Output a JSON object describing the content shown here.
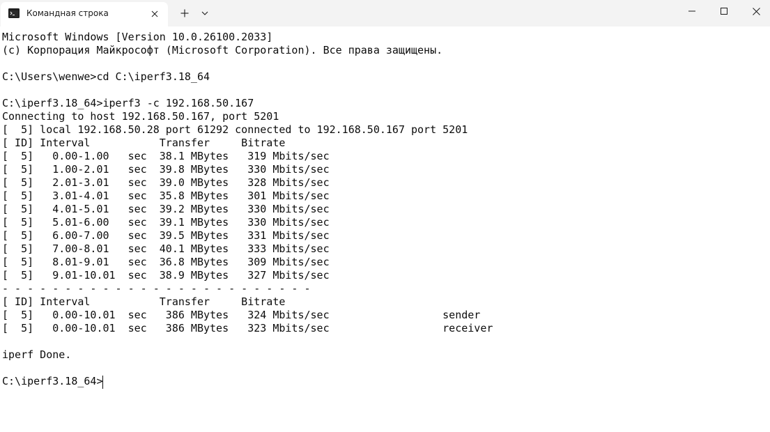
{
  "window": {
    "tab_title": "Командная строка",
    "tab_icon": "console-icon",
    "close_tab_icon": "close-icon",
    "new_tab_icon": "plus-icon",
    "dropdown_icon": "chevron-down-icon",
    "minimize_icon": "minimize-icon",
    "maximize_icon": "maximize-icon",
    "close_icon": "close-icon"
  },
  "console": {
    "lines": [
      "Microsoft Windows [Version 10.0.26100.2033]",
      "(c) Корпорация Майкрософт (Microsoft Corporation). Все права защищены.",
      "",
      "C:\\Users\\wenwe>cd C:\\iperf3.18_64",
      "",
      "C:\\iperf3.18_64>iperf3 -c 192.168.50.167",
      "Connecting to host 192.168.50.167, port 5201",
      "[  5] local 192.168.50.28 port 61292 connected to 192.168.50.167 port 5201",
      "[ ID] Interval           Transfer     Bitrate",
      "[  5]   0.00-1.00   sec  38.1 MBytes   319 Mbits/sec",
      "[  5]   1.00-2.01   sec  39.8 MBytes   330 Mbits/sec",
      "[  5]   2.01-3.01   sec  39.0 MBytes   328 Mbits/sec",
      "[  5]   3.01-4.01   sec  35.8 MBytes   301 Mbits/sec",
      "[  5]   4.01-5.01   sec  39.2 MBytes   330 Mbits/sec",
      "[  5]   5.01-6.00   sec  39.1 MBytes   330 Mbits/sec",
      "[  5]   6.00-7.00   sec  39.5 MBytes   331 Mbits/sec",
      "[  5]   7.00-8.01   sec  40.1 MBytes   333 Mbits/sec",
      "[  5]   8.01-9.01   sec  36.8 MBytes   309 Mbits/sec",
      "[  5]   9.01-10.01  sec  38.9 MBytes   327 Mbits/sec",
      "- - - - - - - - - - - - - - - - - - - - - - - - -",
      "[ ID] Interval           Transfer     Bitrate",
      "[  5]   0.00-10.01  sec   386 MBytes   324 Mbits/sec                  sender",
      "[  5]   0.00-10.01  sec   386 MBytes   323 Mbits/sec                  receiver",
      "",
      "iperf Done.",
      "",
      "C:\\iperf3.18_64>"
    ]
  }
}
